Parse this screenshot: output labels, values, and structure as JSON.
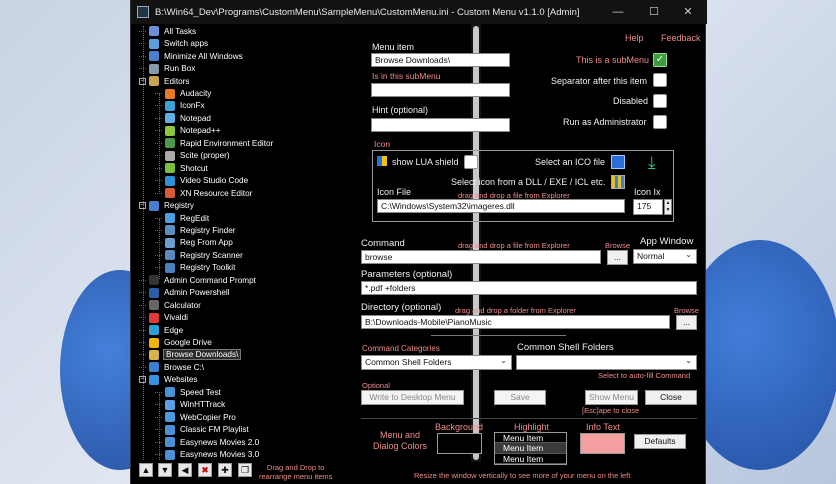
{
  "window": {
    "title": "B:\\Win64_Dev\\Programs\\CustomMenu\\SampleMenu\\CustomMenu.ini - Custom Menu v1.1.0 [Admin]"
  },
  "titlebar_buttons": {
    "minimize": "—",
    "maximize": "☐",
    "close": "✕"
  },
  "tree": [
    {
      "label": "All Tasks",
      "level": 0,
      "icon": "#6b8fd6"
    },
    {
      "label": "Switch apps",
      "level": 0,
      "icon": "#5aa0e0"
    },
    {
      "label": "Minimize All Windows",
      "level": 0,
      "icon": "#4a7fd0"
    },
    {
      "label": "Run Box",
      "level": 0,
      "icon": "#8899aa"
    },
    {
      "label": "Editors",
      "level": 0,
      "icon": "#c9a24a",
      "toggle": "−"
    },
    {
      "label": "Audacity",
      "level": 1,
      "icon": "#e87a22"
    },
    {
      "label": "IconFx",
      "level": 1,
      "icon": "#3aa0d8"
    },
    {
      "label": "Notepad",
      "level": 1,
      "icon": "#5fb0e6"
    },
    {
      "label": "Notepad++",
      "level": 1,
      "icon": "#8ec63f"
    },
    {
      "label": "Rapid Environment Editor",
      "level": 1,
      "icon": "#4a9a4a"
    },
    {
      "label": "Scite (proper)",
      "level": 1,
      "icon": "#aaaaaa"
    },
    {
      "label": "Shotcut",
      "level": 1,
      "icon": "#7bbf3a"
    },
    {
      "label": "Video Studio Code",
      "level": 1,
      "icon": "#2f8fd8"
    },
    {
      "label": "XN Resource Editor",
      "level": 1,
      "icon": "#d85a3a"
    },
    {
      "label": "Registry",
      "level": 0,
      "icon": "#4a7fd0",
      "toggle": "−"
    },
    {
      "label": "RegEdit",
      "level": 1,
      "icon": "#4aa0e0"
    },
    {
      "label": "Registry Finder",
      "level": 1,
      "icon": "#5a90c0"
    },
    {
      "label": "Reg From App",
      "level": 1,
      "icon": "#6aa0d0"
    },
    {
      "label": "Registry Scanner",
      "level": 1,
      "icon": "#5a8ac0"
    },
    {
      "label": "Registry Toolkit",
      "level": 1,
      "icon": "#4a80c0"
    },
    {
      "label": "Admin Command Prompt",
      "level": 0,
      "icon": "#333333"
    },
    {
      "label": "Admin Powershell",
      "level": 0,
      "icon": "#2a5fa8"
    },
    {
      "label": "Calculator",
      "level": 0,
      "icon": "#666666"
    },
    {
      "label": "Vivaldi",
      "level": 0,
      "icon": "#e03a3a"
    },
    {
      "label": "Edge",
      "level": 0,
      "icon": "#2a9fd8"
    },
    {
      "label": "Google Drive",
      "level": 0,
      "icon": "#f2b400"
    },
    {
      "label": "Browse Downloads\\",
      "level": 0,
      "icon": "#d8b44a",
      "selected": true
    },
    {
      "label": "Browse C:\\",
      "level": 0,
      "icon": "#3a7fd0"
    },
    {
      "label": "Websites",
      "level": 0,
      "icon": "#3a90e0",
      "toggle": "−"
    },
    {
      "label": "Speed Test",
      "level": 1,
      "icon": "#4a90d8"
    },
    {
      "label": "WinHTTrack",
      "level": 1,
      "icon": "#5aa0e8"
    },
    {
      "label": "WebCopier Pro",
      "level": 1,
      "icon": "#4a98e0"
    },
    {
      "label": "Classic FM Playlist",
      "level": 1,
      "icon": "#4a90d8"
    },
    {
      "label": "Easynews Movies 2.0",
      "level": 1,
      "icon": "#4a90d8"
    },
    {
      "label": "Easynews Movies 3.0",
      "level": 1,
      "icon": "#4a90d8"
    }
  ],
  "toolbar": {
    "up": "▲",
    "down": "▼",
    "left": "◀",
    "delete": "✖",
    "add": "✚",
    "copy": "❐",
    "hint": "Drag and Drop to\nrearrange menu items"
  },
  "links": {
    "help": "Help",
    "feedback": "Feedback"
  },
  "menu_item": {
    "label": "Menu item",
    "value": "Browse Downloads\\",
    "submenu_note": "Is in this subMenu",
    "submenu_value": ""
  },
  "hint": {
    "label": "Hint (optional)",
    "value": ""
  },
  "options": {
    "is_submenu": "This is a subMenu",
    "separator": "Separator after this item",
    "disabled": "Disabled",
    "run_admin": "Run as Administrator"
  },
  "icon": {
    "group": "Icon",
    "lua_shield": "show LUA shield",
    "select_ico": "Select an ICO file",
    "select_dll": "Select icon from a DLL / EXE / ICL etc.",
    "file_label": "Icon File",
    "file_drag": "drag and drop a file from Explorer",
    "file_value": "C:\\Windows\\System32\\imageres.dll",
    "index_label": "Icon Ix",
    "index_value": "175"
  },
  "command": {
    "label": "Command",
    "drag": "drag and drop a file from Explorer",
    "browse": "Browse",
    "value": "browse",
    "browse_btn": "...",
    "app_window_label": "App Window",
    "app_window_value": "Normal"
  },
  "parameters": {
    "label": "Parameters (optional)",
    "value": "*.pdf +folders"
  },
  "directory": {
    "label": "Directory (optional)",
    "drag": "drag and drop a folder from Explorer",
    "browse": "Browse",
    "value": "B:\\Downloads-Mobile\\PianoMusic",
    "browse_btn": "..."
  },
  "categories": {
    "label": "Command Categories",
    "value": "Common Shell Folders",
    "folders_label": "Common Shell Folders",
    "folders_value": "",
    "autofill": "Select to auto-fill Command"
  },
  "buttons": {
    "optional": "Optional",
    "write_desktop": "Write to Desktop Menu",
    "save": "Save",
    "show_menu": "Show Menu",
    "close": "Close",
    "esc_note": "[Esc]ape to close"
  },
  "colors": {
    "menu_dialog": "Menu and\nDialog Colors",
    "background": "Background",
    "highlight": "Highlight",
    "info_text": "Info Text",
    "defaults": "Defaults",
    "items": [
      "Menu Item",
      "Menu Item",
      "Menu Item"
    ],
    "info_color": "#f4a0a0",
    "pink": "#f08a8a"
  },
  "footer": "Resize the window vertically to see more of your menu on the left"
}
